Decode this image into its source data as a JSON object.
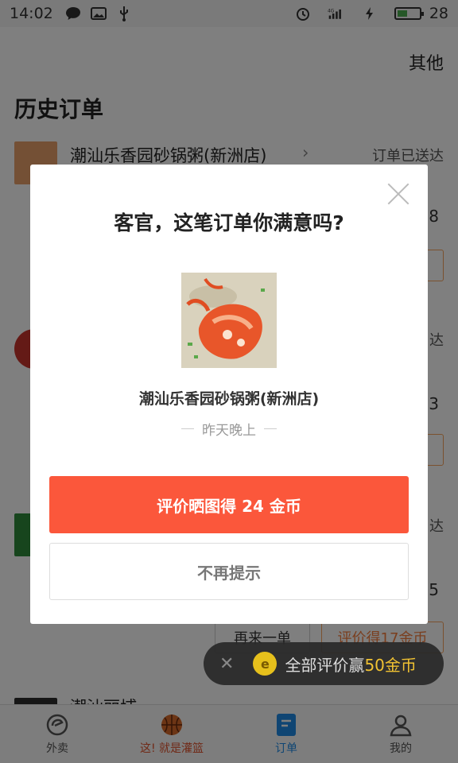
{
  "status_bar": {
    "time": "14:02",
    "battery_level": "28",
    "network": "4G"
  },
  "header": {
    "other_label": "其他",
    "title": "历史订单"
  },
  "orders": [
    {
      "name": "潮汕乐香园砂锅粥(新洲店)",
      "status": "订单已送达",
      "price_fragment": ".8"
    },
    {
      "status_fragment": "达",
      "price_fragment": ".3"
    },
    {
      "status_fragment": "达",
      "price_fragment": ".5",
      "reorder_label": "再来一单",
      "review_label": "评价得17金币"
    },
    {
      "name_fragment": "潮汕丽埔"
    }
  ],
  "coin_toast": {
    "text_prefix": "全部评价赢",
    "amount": "50金币"
  },
  "modal": {
    "title": "客官，这笔订单你满意吗?",
    "shop_name": "潮汕乐香园砂锅粥(新洲店)",
    "time_text": "昨天晚上",
    "primary_label": "评价晒图得 24 金币",
    "secondary_label": "不再提示"
  },
  "tabs": [
    {
      "label": "外卖",
      "icon": "eleme-icon"
    },
    {
      "label": "这! 就是灌篮",
      "icon": "basketball-icon"
    },
    {
      "label": "订单",
      "icon": "order-icon",
      "active": true
    },
    {
      "label": "我的",
      "icon": "profile-icon"
    }
  ],
  "colors": {
    "accent_orange": "#fb573b",
    "active_tab_blue": "#1e8ae6",
    "coin_gold": "#f1c232"
  }
}
